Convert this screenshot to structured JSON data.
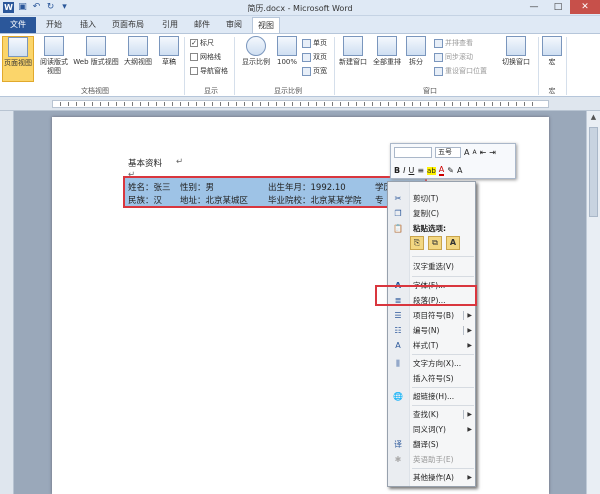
{
  "window": {
    "title": "简历.docx - Microsoft Word"
  },
  "tabs": {
    "file": "文件",
    "start": "开始",
    "insert": "插入",
    "layout": "页面布局",
    "ref": "引用",
    "mail": "邮件",
    "review": "审阅",
    "view": "视图"
  },
  "ribbon": {
    "page_view": "页面视图",
    "read_view": "阅读版式视图",
    "web_view": "Web 版式视图",
    "outline_view": "大纲视图",
    "draft_view": "草稿",
    "group_doc_views": "文档视图",
    "ruler": "标尺",
    "gridlines": "网格线",
    "nav_pane": "导航窗格",
    "group_show": "显示",
    "zoom": "显示比例",
    "zoom100": "100%",
    "one_page": "单页",
    "two_pages": "双页",
    "page_width": "页宽",
    "group_zoom": "显示比例",
    "new_window": "新建窗口",
    "arrange_all": "全部重排",
    "split": "拆分",
    "side_by_side": "并排查看",
    "sync_scroll": "同步滚动",
    "reset_pos": "重设窗口位置",
    "switch_window": "切换窗口",
    "group_window": "窗口",
    "macros": "宏",
    "group_macros": "宏"
  },
  "document": {
    "heading": "基本资料",
    "row1": {
      "name": "姓名：张三",
      "gender": "性别：男",
      "birth": "出生年月：1992.10",
      "edu": "学历：本科"
    },
    "row2": {
      "nation": "民族：汉",
      "addr": "地址：北京某城区",
      "school": "毕业院校：北京某某学院",
      "major": "专"
    }
  },
  "mini_toolbar": {
    "font": "",
    "size": "五号",
    "bold": "B",
    "italic": "I",
    "underline": "U",
    "center": "≡",
    "hilite": "ab",
    "fontcolor": "A",
    "format": "✎",
    "grow": "A",
    "shrink": "A",
    "indent_dec": "⇤",
    "indent_inc": "⇥",
    "painter": "▤",
    "style": "A"
  },
  "context_menu": {
    "cut": "剪切(T)",
    "copy": "复制(C)",
    "paste_options": "粘贴选项:",
    "reconvert": "汉字重选(V)",
    "font": "字体(F)...",
    "paragraph": "段落(P)...",
    "bullets": "项目符号(B)",
    "numbering": "编号(N)",
    "styles": "样式(T)",
    "text_direction": "文字方向(X)...",
    "insert_symbol": "插入符号(S)",
    "hyperlink": "超链接(H)...",
    "lookup": "查找(K)",
    "synonyms": "同义词(Y)",
    "translate": "翻译(S)",
    "english_assist": "英语助手(E)",
    "other_actions": "其他操作(A)"
  }
}
